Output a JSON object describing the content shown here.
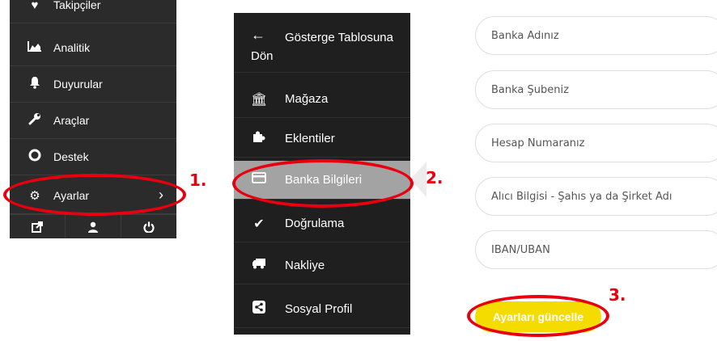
{
  "left_menu": {
    "items": [
      {
        "label": "Takipçiler",
        "icon": "heart-icon"
      },
      {
        "label": "Analitik",
        "icon": "area-chart-icon"
      },
      {
        "label": "Duyurular",
        "icon": "bell-icon"
      },
      {
        "label": "Araçlar",
        "icon": "wrench-icon"
      },
      {
        "label": "Destek",
        "icon": "lifebuoy-icon"
      },
      {
        "label": "Ayarlar",
        "icon": "gear-icon"
      }
    ],
    "footer_icons": [
      "external-link-icon",
      "user-icon",
      "power-icon"
    ]
  },
  "settings_menu": {
    "back_label": "Gösterge Tablosuna Dön",
    "items": [
      {
        "label": "Mağaza",
        "icon": "bank-icon"
      },
      {
        "label": "Eklentiler",
        "icon": "puzzle-icon"
      },
      {
        "label": "Banka Bilgileri",
        "icon": "credit-card-icon",
        "active": true
      },
      {
        "label": "Doğrulama",
        "icon": "check-icon"
      },
      {
        "label": "Nakliye",
        "icon": "truck-icon"
      },
      {
        "label": "Sosyal Profil",
        "icon": "share-icon"
      }
    ]
  },
  "bank_form": {
    "fields": [
      {
        "placeholder": "Banka Adınız"
      },
      {
        "placeholder": "Banka Şubeniz"
      },
      {
        "placeholder": "Hesap Numaranız"
      },
      {
        "placeholder": "Alıcı Bilgisi - Şahıs ya da Şirket Adı"
      },
      {
        "placeholder": "IBAN/UBAN"
      }
    ],
    "submit_label": "Ayarları güncelle"
  },
  "annotations": {
    "step1": "1.",
    "step2": "2.",
    "step3": "3.",
    "color": "#e8000f"
  },
  "colors": {
    "menu_bg": "#2b2b2b",
    "active_item_bg": "#a3a3a3",
    "button_bg": "#f5dc00"
  }
}
